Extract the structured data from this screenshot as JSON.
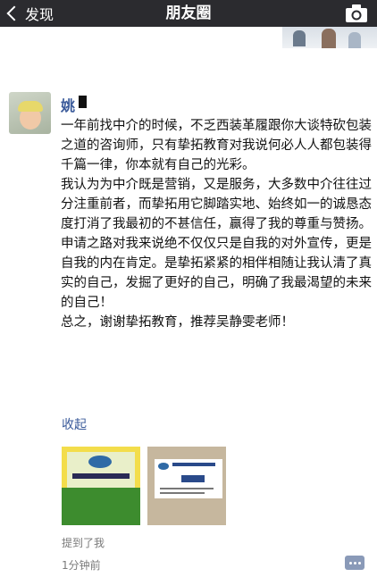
{
  "navbar": {
    "back_label": "发现",
    "title": "朋友圈"
  },
  "post": {
    "username": "姚",
    "paragraphs": [
      "一年前找中介的时候，不乏西装革履跟你大谈特砍包装之道的咨询师，只有挚拓教育对我说何必人人都包装得千篇一律，你本就有自己的光彩。",
      "我认为为中介既是营销，又是服务，大多数中介往往过分注重前者，而挚拓用它脚踏实地、始终如一的诚恳态度打消了我最初的不甚信任，赢得了我的尊重与赞扬。",
      "申请之路对我来说绝不仅仅只是自我的对外宣传，更是自我的内在肯定。是挚拓紧紧的相伴相随让我认清了真实的自己，发掘了更好的自己，明确了我最渴望的未来的自己！",
      "总之，谢谢挚拓教育，推荐吴静雯老师！"
    ],
    "collapse_label": "收起",
    "mention_text": "提到了我",
    "time_text": "1分钟前"
  },
  "colors": {
    "navbar_bg": "#2b2b2f",
    "link_blue": "#3a5a9a",
    "meta_gray": "#7a7a7a"
  },
  "icons": {
    "back": "chevron-left-icon",
    "camera": "camera-icon",
    "comment": "comment-dots-icon"
  }
}
